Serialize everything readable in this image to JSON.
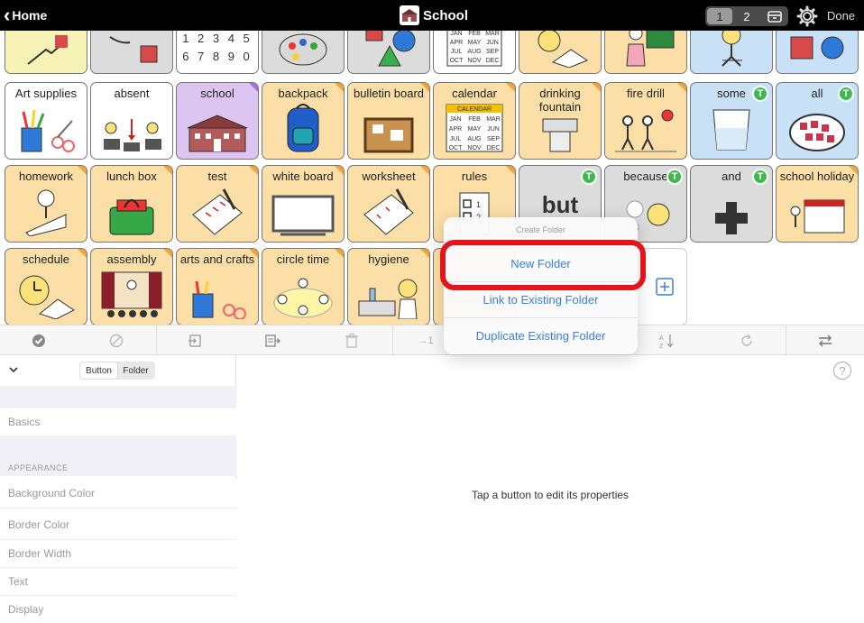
{
  "topbar": {
    "home_label": "Home",
    "title": "School",
    "pages": [
      "1",
      "2"
    ],
    "active_page": "1",
    "done_label": "Done"
  },
  "grid": {
    "row1": [
      {
        "label": "",
        "icon": "pointing-hand-picture",
        "bg": "#f7f2b6"
      },
      {
        "label": "",
        "icon": "hand-square-picture",
        "bg": "#dcdcdc"
      },
      {
        "label": "12345 67890",
        "icon": "numbers-picture",
        "bg": "#ffffff"
      },
      {
        "label": "",
        "icon": "paint-palette-picture",
        "bg": "#dcdcdc"
      },
      {
        "label": "",
        "icon": "shapes-picture",
        "bg": "#dcdcdc"
      },
      {
        "label": "",
        "icon": "calendar-months-picture",
        "bg": "#ffffff"
      },
      {
        "label": "",
        "icon": "clock-book-picture",
        "bg": "#fbdfa6"
      },
      {
        "label": "",
        "icon": "teacher-picture",
        "bg": "#fbdfa6"
      },
      {
        "label": "",
        "icon": "upset-person-picture",
        "bg": "#c8e1f6"
      },
      {
        "label": "",
        "icon": "square-circle-picture",
        "bg": "#c8e1f6"
      }
    ],
    "row2": [
      {
        "label": "Art supplies",
        "icon": "art-supplies-picture"
      },
      {
        "label": "absent",
        "icon": "absent-picture"
      },
      {
        "label": "school",
        "icon": "school-building-picture"
      },
      {
        "label": "backpack",
        "icon": "backpack-picture"
      },
      {
        "label": "bulletin board",
        "icon": "bulletin-board-picture"
      },
      {
        "label": "calendar",
        "icon": "calendar-picture"
      },
      {
        "label": "drinking fountain",
        "icon": "drinking-fountain-picture"
      },
      {
        "label": "fire drill",
        "icon": "fire-drill-picture"
      },
      {
        "label": "some",
        "icon": "glass-picture",
        "badge": "T"
      },
      {
        "label": "all",
        "icon": "all-picture",
        "badge": "T"
      }
    ],
    "row3": [
      {
        "label": "homework",
        "icon": "homework-picture"
      },
      {
        "label": "lunch box",
        "icon": "lunch-box-picture"
      },
      {
        "label": "test",
        "icon": "test-paper-picture"
      },
      {
        "label": "white board",
        "icon": "white-board-picture"
      },
      {
        "label": "worksheet",
        "icon": "worksheet-picture"
      },
      {
        "label": "rules",
        "icon": "rules-picture"
      },
      {
        "label": "but",
        "icon": "but-word",
        "badge": "T"
      },
      {
        "label": "because",
        "icon": "because-picture",
        "badge": "T"
      },
      {
        "label": "and",
        "icon": "plus-picture",
        "badge": "T"
      },
      {
        "label": "school holiday",
        "icon": "school-holiday-picture"
      }
    ],
    "row4": [
      {
        "label": "schedule",
        "icon": "schedule-picture"
      },
      {
        "label": "assembly",
        "icon": "assembly-picture"
      },
      {
        "label": "arts and crafts",
        "icon": "arts-crafts-picture"
      },
      {
        "label": "circle time",
        "icon": "circle-time-picture"
      },
      {
        "label": "hygiene",
        "icon": "hygiene-picture"
      }
    ],
    "add_icon": "add-folder-icon"
  },
  "toolbar": {
    "items": [
      "check-icon",
      "no-select-icon",
      "import-icon",
      "copy-icon",
      "trash-icon",
      "move-icon",
      "sort-icon",
      "refresh-icon",
      "swap-icon"
    ],
    "move_label": "→1"
  },
  "inspector": {
    "tabs": [
      "Button",
      "Folder"
    ],
    "active_tab": "Button",
    "basics_label": "Basics",
    "appearance_label": "APPEARANCE",
    "rows": [
      "Background Color",
      "Border Color",
      "Border Width",
      "Text",
      "Display"
    ]
  },
  "main_panel": {
    "hint": "Tap a button to edit its properties"
  },
  "popover": {
    "title": "Create Folder",
    "options": [
      "New Folder",
      "Link to Existing Folder",
      "Duplicate Existing Folder"
    ]
  },
  "colors": {
    "folder_bg": "#fbdfa6",
    "folder_tab": "#f2a33a",
    "link_blue": "#3b7fd9",
    "badge_green": "#3fb84d",
    "highlight_red": "#e3141b"
  }
}
